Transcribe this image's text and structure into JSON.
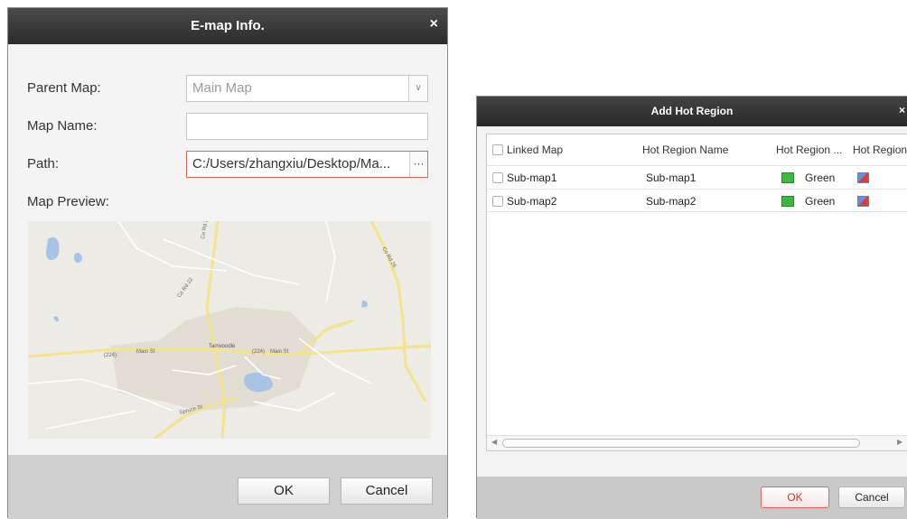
{
  "emap_dialog": {
    "title": "E-map Info.",
    "close_glyph": "×",
    "parent_map": {
      "label": "Parent Map:",
      "value": "Main Map"
    },
    "map_name": {
      "label": "Map Name:",
      "value": ""
    },
    "path": {
      "label": "Path:",
      "value": "C:/Users/zhangxiu/Desktop/Ma...",
      "browse_glyph": "···"
    },
    "map_preview": {
      "label": "Map Preview:",
      "labels": [
        "Main St",
        "Main St",
        "Tarrwoodle",
        "(224)",
        "(224)",
        "Spruce St",
        "Co Rd 25",
        "Co Rd 22",
        "Co Rd 26"
      ]
    },
    "ok_label": "OK",
    "cancel_label": "Cancel"
  },
  "hot_region_dialog": {
    "title": "Add Hot Region",
    "close_glyph": "×",
    "columns": [
      "Linked Map",
      "Hot Region Name",
      "Hot Region ...",
      "Hot Region"
    ],
    "rows": [
      {
        "linked_map": "Sub-map1",
        "name": "Sub-map1",
        "color_name": "Green"
      },
      {
        "linked_map": "Sub-map2",
        "name": "Sub-map2",
        "color_name": "Green"
      }
    ],
    "ok_label": "OK",
    "cancel_label": "Cancel"
  },
  "colors": {
    "hot_region_green": "#3cb83c",
    "ok_highlight_border": "#e06666"
  }
}
